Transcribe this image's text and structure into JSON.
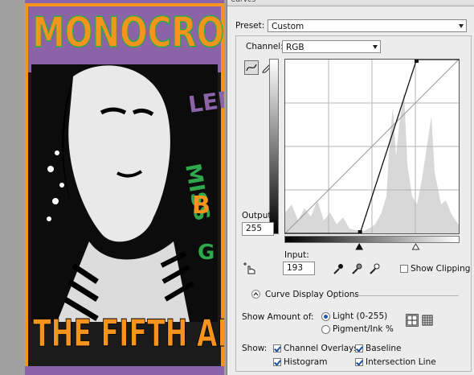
{
  "dialog": {
    "title": "Curves"
  },
  "preset": {
    "label": "Preset:",
    "value": "Custom"
  },
  "channel": {
    "label": "Channel:",
    "value": "RGB"
  },
  "output": {
    "label": "Output:",
    "value": "255"
  },
  "input": {
    "label": "Input:",
    "value": "193"
  },
  "show_clipping": {
    "label": "Show Clipping",
    "checked": false
  },
  "curve_display_options": {
    "label": "Curve Display Options",
    "icon": "collapse-chevron-icon"
  },
  "show_amount": {
    "label": "Show Amount of:",
    "light": {
      "label": "Light  (0-255)",
      "selected": true
    },
    "pigment": {
      "label": "Pigment/Ink %",
      "selected": false
    }
  },
  "show": {
    "label": "Show:",
    "channel_overlays": {
      "label": "Channel Overlays",
      "checked": true
    },
    "baseline": {
      "label": "Baseline",
      "checked": true
    },
    "histogram": {
      "label": "Histogram",
      "checked": true
    },
    "intersection_line": {
      "label": "Intersection Line",
      "checked": true
    }
  },
  "curve": {
    "points": [
      [
        0,
        0
      ],
      [
        110,
        0
      ],
      [
        193,
        255
      ],
      [
        255,
        255
      ]
    ],
    "input_black": 110,
    "input_white": 193
  },
  "artwork": {
    "title": "MONOCRO",
    "bottom_text": "THE FIFTH ALB",
    "side_text": [
      "LEE",
      "MISS",
      "B",
      "G"
    ]
  },
  "colors": {
    "orange": "#f7941d",
    "purple": "#8b63a7",
    "green": "#2ea84a",
    "dialog_bg": "#ececec",
    "histogram": "#d8d8d8"
  }
}
